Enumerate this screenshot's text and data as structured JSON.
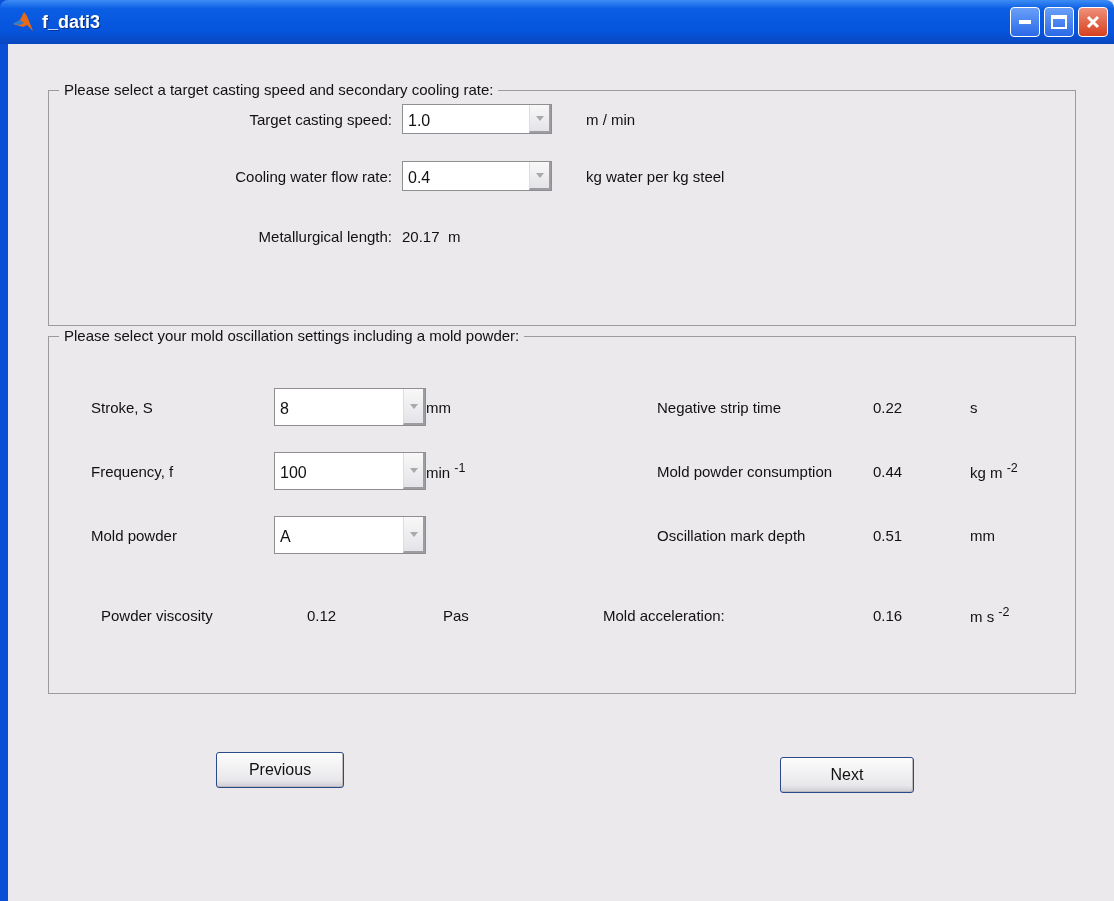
{
  "window": {
    "title": "f_dati3"
  },
  "speed_panel": {
    "legend": "Please select a target casting speed and secondary cooling rate:",
    "fields": [
      {
        "label": "Target casting speed:",
        "value": "1.0",
        "unit": "m / min"
      },
      {
        "label": "Cooling water flow rate:",
        "value": "0.4",
        "unit": "kg water per kg steel"
      }
    ],
    "result": {
      "label": "Metallurgical length:",
      "value": "20.17",
      "unit": "m"
    }
  },
  "mold_panel": {
    "legend": "Please select your mold oscillation settings including a mold powder:",
    "rows": [
      {
        "label": "Stroke, S",
        "value": "8",
        "unit": "mm",
        "result_label": "Negative strip time",
        "result_value": "0.22",
        "result_unit": "s"
      },
      {
        "label": "Frequency, f",
        "value": "100",
        "unit": "min $^{-1}$",
        "result_label": "Mold powder consumption",
        "result_value": "0.44",
        "result_unit": "kg m $^{-2}$"
      },
      {
        "label": "Mold powder",
        "value": "A",
        "result_label": "Oscillation mark depth",
        "result_value": "0.51",
        "result_unit": "mm"
      }
    ],
    "viscosity": {
      "label": "Powder viscosity",
      "value": "0.12",
      "unit": "Pas"
    },
    "acceleration": {
      "label": "Mold acceleration:",
      "value": "0.16",
      "unit": "m s $^{-2}$"
    }
  },
  "buttons": [
    "Previous",
    "Next"
  ]
}
